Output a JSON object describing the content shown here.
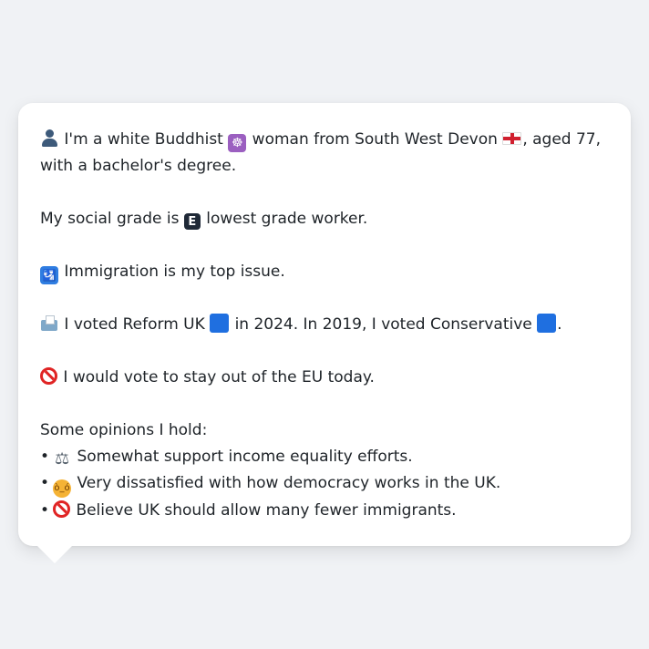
{
  "profile": {
    "identity_line_1_a": "I'm a white Buddhist",
    "identity_line_1_b": "woman from South West Devon",
    "identity_line_1_c": ", aged 77,",
    "identity_line_2": "with a bachelor's degree.",
    "social_grade_a": "My social grade is",
    "social_grade_letter": "E",
    "social_grade_b": "lowest grade worker.",
    "top_issue": "Immigration is my top issue.",
    "vote_a": "I voted Reform UK",
    "vote_b": "in 2024. In 2019, I voted Conservative",
    "vote_c": ".",
    "eu_stance": "I would vote to stay out of the EU today.",
    "opinions_heading": "Some opinions I hold:",
    "opinions": [
      {
        "bullet": "•",
        "text": "Somewhat support income equality efforts.",
        "icon": "balance-scale-icon"
      },
      {
        "bullet": "•",
        "text": "Very dissatisfied with how democracy works in the UK.",
        "icon": "angry-face-icon"
      },
      {
        "bullet": "•",
        "text": "Believe UK should allow many fewer immigrants.",
        "icon": "prohibited-icon"
      }
    ]
  },
  "icons": {
    "person": "person-silhouette-icon",
    "religion": "wheel-of-dharma-icon",
    "flag": "england-flag-icon",
    "grade": "letter-e-icon",
    "issue": "passport-control-icon",
    "ballot": "ballot-box-icon",
    "party_2024": "blue-square-icon",
    "party_2019": "blue-square-icon",
    "eu": "prohibited-icon"
  },
  "colors": {
    "background": "#f0f2f5",
    "card": "#ffffff",
    "text": "#1e2328",
    "party_blue": "#1f6fe0",
    "prohibited_red": "#e02424",
    "dharma_purple": "#9b5fc0"
  }
}
